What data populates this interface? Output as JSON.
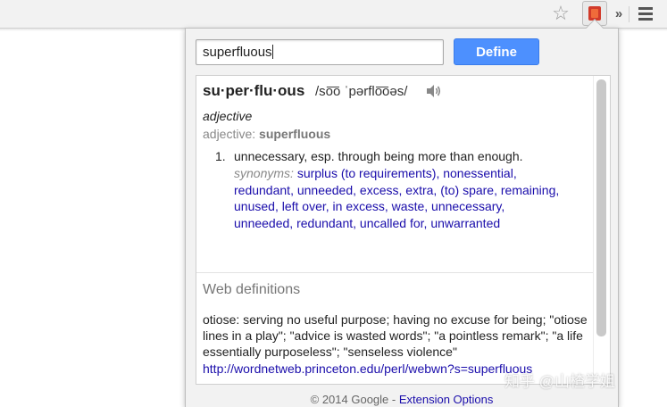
{
  "toolbar": {
    "star_icon": "star-icon",
    "extension_icon": "dictionary-extension-icon",
    "overflow_label": "»",
    "menu_icon": "hamburger-menu-icon"
  },
  "search": {
    "value": "superfluous",
    "define_label": "Define"
  },
  "entry": {
    "headword": "su·per·flu·ous",
    "pronunciation": "/so͞o ˈpərflo͞oəs/",
    "speaker_icon": "speaker-icon",
    "part_of_speech": "adjective",
    "pos_prefix": "adjective:",
    "pos_word": "superfluous",
    "sense_number": "1.",
    "definition": "unnecessary, esp. through being more than enough.",
    "synonyms_label": "synonyms:",
    "synonyms": [
      "surplus (to requirements)",
      "nonessential",
      "redundant",
      "unneeded",
      "excess",
      "extra",
      "(to) spare",
      "remaining",
      "unused",
      "left over",
      "in excess",
      "waste",
      "unnecessary",
      "unneeded",
      "redundant",
      "uncalled for",
      "unwarranted"
    ]
  },
  "web": {
    "heading": "Web definitions",
    "text": "otiose: serving no useful purpose; having no excuse for being; \"otiose lines in a play\"; \"advice is wasted words\"; \"a pointless remark\"; \"a life essentially purposeless\"; \"senseless violence\"",
    "url": "http://wordnetweb.princeton.edu/perl/webwn?s=superfluous"
  },
  "footer": {
    "copyright": "© 2014 Google -",
    "options_link": "Extension Options"
  },
  "watermark": "知乎 @山楂学姐",
  "colors": {
    "accent": "#4d90fe",
    "link": "#1a0dab"
  }
}
